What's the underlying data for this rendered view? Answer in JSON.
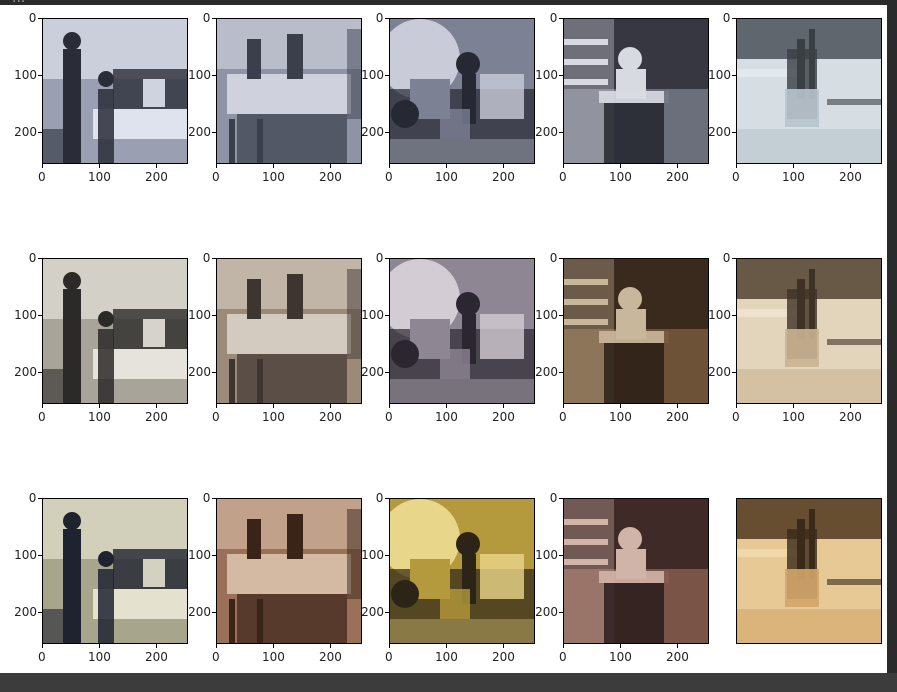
{
  "header_text": "...",
  "axis_ticks": {
    "y": [
      "0",
      "100",
      "200"
    ],
    "x": [
      "0",
      "100",
      "200"
    ]
  },
  "rows": [
    {
      "row": "row-1-grayscale-input",
      "tint": "#8f96a8",
      "panels": [
        {
          "scene": "lab-two-men-workstation",
          "base": "#9aa0b2",
          "dark": "#2a2d38",
          "light": "#dfe3ee"
        },
        {
          "scene": "office-kitchen-counter",
          "base": "#8e93a6",
          "dark": "#3b3e4b",
          "light": "#d6d9e3"
        },
        {
          "scene": "vintage-caravan-toys",
          "base": "#7c8194",
          "dark": "#262833",
          "light": "#c9ccd8"
        },
        {
          "scene": "baby-high-chair",
          "base": "#6c6f7c",
          "dark": "#1f2028",
          "light": "#d8dae2"
        },
        {
          "scene": "table-desk-organizer",
          "base": "#b8c4cc",
          "dark": "#3a3f44",
          "light": "#e2e8ec"
        }
      ]
    },
    {
      "row": "row-2-colorized-output",
      "tint": "#8a7a66",
      "panels": [
        {
          "scene": "lab-two-men-workstation",
          "base": "#a8a49a",
          "dark": "#2c2a28",
          "light": "#e6e3dc"
        },
        {
          "scene": "office-kitchen-counter",
          "base": "#9c8a78",
          "dark": "#3e3530",
          "light": "#dad2c8"
        },
        {
          "scene": "vintage-caravan-toys",
          "base": "#8e8692",
          "dark": "#2b2630",
          "light": "#d4ccd4"
        },
        {
          "scene": "baby-high-chair",
          "base": "#6e5238",
          "dark": "#241a12",
          "light": "#c9b79c"
        },
        {
          "scene": "table-desk-organizer",
          "base": "#c9b494",
          "dark": "#3e3226",
          "light": "#eee2cc"
        }
      ]
    },
    {
      "row": "row-3-ground-truth",
      "tint": "#9a8a6c",
      "panels": [
        {
          "scene": "lab-two-men-workstation",
          "base": "#a7a68c",
          "dark": "#1f2330",
          "light": "#e4e2cf"
        },
        {
          "scene": "office-kitchen-counter",
          "base": "#9a7058",
          "dark": "#3a2418",
          "light": "#dcc2ac"
        },
        {
          "scene": "vintage-caravan-toys",
          "base": "#b49a3c",
          "dark": "#2c2416",
          "light": "#e8d68a"
        },
        {
          "scene": "baby-high-chair",
          "base": "#7a5446",
          "dark": "#26181a",
          "light": "#d0b4a8"
        },
        {
          "scene": "table-desk-organizer",
          "base": "#d2a66a",
          "dark": "#3a2a1a",
          "light": "#f0d8a8"
        }
      ]
    }
  ]
}
